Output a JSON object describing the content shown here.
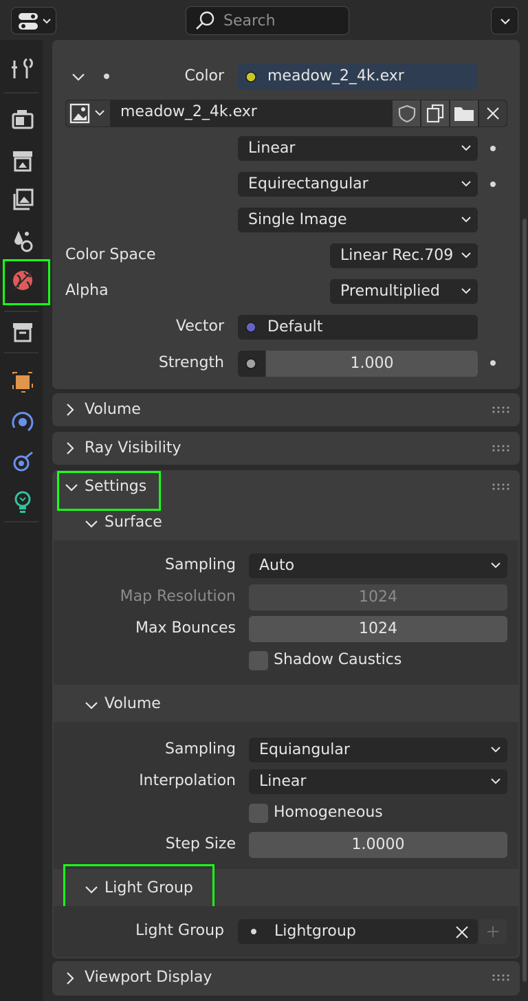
{
  "header": {
    "search_placeholder": "Search",
    "editor_type_icon": "properties-editor-icon",
    "options_icon": "chevron-down-icon"
  },
  "sidebar": {
    "tabs": [
      "tool",
      "render",
      "output",
      "view-layer",
      "scene",
      "world",
      "collection",
      "object",
      "physics",
      "constraints",
      "data"
    ],
    "active_tab": "world"
  },
  "surface": {
    "color_label": "Color",
    "color_value": "meadow_2_4k.exr",
    "image_name": "meadow_2_4k.exr",
    "interpolation": "Linear",
    "projection": "Equirectangular",
    "source": "Single Image",
    "color_space_label": "Color Space",
    "color_space": "Linear Rec.709",
    "alpha_label": "Alpha",
    "alpha": "Premultiplied",
    "vector_label": "Vector",
    "vector_value": "Default",
    "strength_label": "Strength",
    "strength_value": "1.000"
  },
  "panels": {
    "volume": "Volume",
    "ray_visibility": "Ray Visibility",
    "settings": "Settings",
    "viewport_display": "Viewport Display"
  },
  "settings": {
    "surface_title": "Surface",
    "sampling_label": "Sampling",
    "sampling_value": "Auto",
    "map_resolution_label": "Map Resolution",
    "map_resolution_value": "1024",
    "max_bounces_label": "Max Bounces",
    "max_bounces_value": "1024",
    "shadow_caustics_label": "Shadow Caustics",
    "volume_title": "Volume",
    "vol_sampling_label": "Sampling",
    "vol_sampling_value": "Equiangular",
    "interpolation_label": "Interpolation",
    "interpolation_value": "Linear",
    "homogeneous_label": "Homogeneous",
    "step_size_label": "Step Size",
    "step_size_value": "1.0000",
    "light_group_title": "Light Group",
    "light_group_label": "Light Group",
    "light_group_value": "Lightgroup"
  },
  "colors": {
    "highlight": "#19ff19",
    "color_socket": "#c7c729",
    "vector_socket": "#6363c7",
    "strength_socket": "#a1a1a1",
    "world_icon": "#e05a5a"
  }
}
